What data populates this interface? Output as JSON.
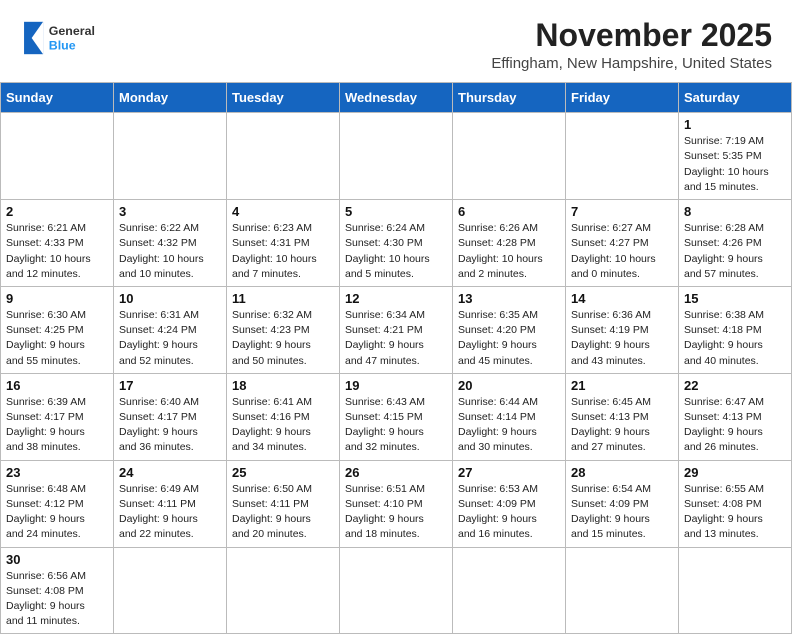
{
  "header": {
    "month_title": "November 2025",
    "location": "Effingham, New Hampshire, United States"
  },
  "logo": {
    "text_general": "General",
    "text_blue": "Blue"
  },
  "days_of_week": [
    "Sunday",
    "Monday",
    "Tuesday",
    "Wednesday",
    "Thursday",
    "Friday",
    "Saturday"
  ],
  "weeks": [
    [
      {
        "day": "",
        "info": ""
      },
      {
        "day": "",
        "info": ""
      },
      {
        "day": "",
        "info": ""
      },
      {
        "day": "",
        "info": ""
      },
      {
        "day": "",
        "info": ""
      },
      {
        "day": "",
        "info": ""
      },
      {
        "day": "1",
        "info": "Sunrise: 7:19 AM\nSunset: 5:35 PM\nDaylight: 10 hours\nand 15 minutes."
      }
    ],
    [
      {
        "day": "2",
        "info": "Sunrise: 6:21 AM\nSunset: 4:33 PM\nDaylight: 10 hours\nand 12 minutes."
      },
      {
        "day": "3",
        "info": "Sunrise: 6:22 AM\nSunset: 4:32 PM\nDaylight: 10 hours\nand 10 minutes."
      },
      {
        "day": "4",
        "info": "Sunrise: 6:23 AM\nSunset: 4:31 PM\nDaylight: 10 hours\nand 7 minutes."
      },
      {
        "day": "5",
        "info": "Sunrise: 6:24 AM\nSunset: 4:30 PM\nDaylight: 10 hours\nand 5 minutes."
      },
      {
        "day": "6",
        "info": "Sunrise: 6:26 AM\nSunset: 4:28 PM\nDaylight: 10 hours\nand 2 minutes."
      },
      {
        "day": "7",
        "info": "Sunrise: 6:27 AM\nSunset: 4:27 PM\nDaylight: 10 hours\nand 0 minutes."
      },
      {
        "day": "8",
        "info": "Sunrise: 6:28 AM\nSunset: 4:26 PM\nDaylight: 9 hours\nand 57 minutes."
      }
    ],
    [
      {
        "day": "9",
        "info": "Sunrise: 6:30 AM\nSunset: 4:25 PM\nDaylight: 9 hours\nand 55 minutes."
      },
      {
        "day": "10",
        "info": "Sunrise: 6:31 AM\nSunset: 4:24 PM\nDaylight: 9 hours\nand 52 minutes."
      },
      {
        "day": "11",
        "info": "Sunrise: 6:32 AM\nSunset: 4:23 PM\nDaylight: 9 hours\nand 50 minutes."
      },
      {
        "day": "12",
        "info": "Sunrise: 6:34 AM\nSunset: 4:21 PM\nDaylight: 9 hours\nand 47 minutes."
      },
      {
        "day": "13",
        "info": "Sunrise: 6:35 AM\nSunset: 4:20 PM\nDaylight: 9 hours\nand 45 minutes."
      },
      {
        "day": "14",
        "info": "Sunrise: 6:36 AM\nSunset: 4:19 PM\nDaylight: 9 hours\nand 43 minutes."
      },
      {
        "day": "15",
        "info": "Sunrise: 6:38 AM\nSunset: 4:18 PM\nDaylight: 9 hours\nand 40 minutes."
      }
    ],
    [
      {
        "day": "16",
        "info": "Sunrise: 6:39 AM\nSunset: 4:17 PM\nDaylight: 9 hours\nand 38 minutes."
      },
      {
        "day": "17",
        "info": "Sunrise: 6:40 AM\nSunset: 4:17 PM\nDaylight: 9 hours\nand 36 minutes."
      },
      {
        "day": "18",
        "info": "Sunrise: 6:41 AM\nSunset: 4:16 PM\nDaylight: 9 hours\nand 34 minutes."
      },
      {
        "day": "19",
        "info": "Sunrise: 6:43 AM\nSunset: 4:15 PM\nDaylight: 9 hours\nand 32 minutes."
      },
      {
        "day": "20",
        "info": "Sunrise: 6:44 AM\nSunset: 4:14 PM\nDaylight: 9 hours\nand 30 minutes."
      },
      {
        "day": "21",
        "info": "Sunrise: 6:45 AM\nSunset: 4:13 PM\nDaylight: 9 hours\nand 27 minutes."
      },
      {
        "day": "22",
        "info": "Sunrise: 6:47 AM\nSunset: 4:13 PM\nDaylight: 9 hours\nand 26 minutes."
      }
    ],
    [
      {
        "day": "23",
        "info": "Sunrise: 6:48 AM\nSunset: 4:12 PM\nDaylight: 9 hours\nand 24 minutes."
      },
      {
        "day": "24",
        "info": "Sunrise: 6:49 AM\nSunset: 4:11 PM\nDaylight: 9 hours\nand 22 minutes."
      },
      {
        "day": "25",
        "info": "Sunrise: 6:50 AM\nSunset: 4:11 PM\nDaylight: 9 hours\nand 20 minutes."
      },
      {
        "day": "26",
        "info": "Sunrise: 6:51 AM\nSunset: 4:10 PM\nDaylight: 9 hours\nand 18 minutes."
      },
      {
        "day": "27",
        "info": "Sunrise: 6:53 AM\nSunset: 4:09 PM\nDaylight: 9 hours\nand 16 minutes."
      },
      {
        "day": "28",
        "info": "Sunrise: 6:54 AM\nSunset: 4:09 PM\nDaylight: 9 hours\nand 15 minutes."
      },
      {
        "day": "29",
        "info": "Sunrise: 6:55 AM\nSunset: 4:08 PM\nDaylight: 9 hours\nand 13 minutes."
      }
    ],
    [
      {
        "day": "30",
        "info": "Sunrise: 6:56 AM\nSunset: 4:08 PM\nDaylight: 9 hours\nand 11 minutes."
      },
      {
        "day": "",
        "info": ""
      },
      {
        "day": "",
        "info": ""
      },
      {
        "day": "",
        "info": ""
      },
      {
        "day": "",
        "info": ""
      },
      {
        "day": "",
        "info": ""
      },
      {
        "day": "",
        "info": ""
      }
    ]
  ]
}
